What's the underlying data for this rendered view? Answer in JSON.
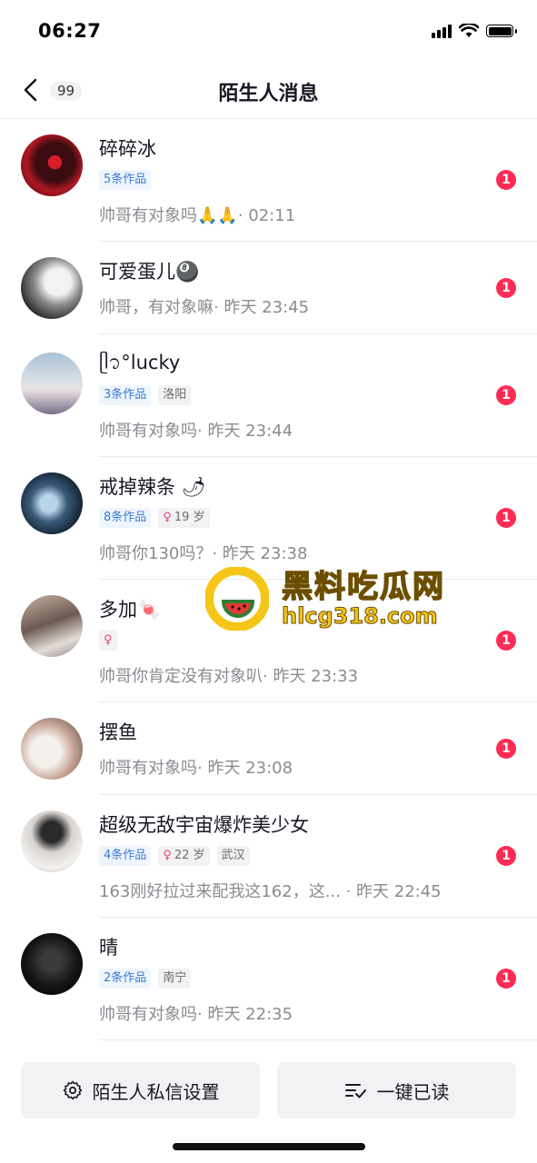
{
  "status_bar": {
    "time": "06:27"
  },
  "nav": {
    "unread_count": "99",
    "title": "陌生人消息"
  },
  "messages": [
    {
      "name": "碎碎冰",
      "tags": [
        "5条作品"
      ],
      "preview": "帅哥有对象吗🙏🙏· 02:11",
      "badge": "1"
    },
    {
      "name": "可爱蛋儿🎱",
      "tags": [],
      "preview": "帅哥，有对象嘛· 昨天 23:45",
      "badge": "1"
    },
    {
      "name": "ᥫ᭡°lucky",
      "tags": [
        "3条作品",
        "洛阳"
      ],
      "preview": "帅哥有对象吗· 昨天 23:44",
      "badge": "1"
    },
    {
      "name": "戒掉辣条 🌶",
      "tags": [
        "8条作品",
        "19 岁"
      ],
      "preview": "帅哥你130吗？· 昨天 23:38",
      "badge": "1"
    },
    {
      "name": "多加🍬",
      "tags": [
        ""
      ],
      "preview": "帅哥你肯定没有对象叭· 昨天 23:33",
      "badge": "1"
    },
    {
      "name": "摆鱼",
      "tags": [],
      "preview": "帅哥有对象吗· 昨天 23:08",
      "badge": "1"
    },
    {
      "name": "超级无敌宇宙爆炸美少女",
      "tags": [
        "4条作品",
        "22 岁",
        "武汉"
      ],
      "preview": "163刚好拉过来配我这162，这...  · 昨天 22:45",
      "badge": "1"
    },
    {
      "name": "晴",
      "tags": [
        "2条作品",
        "南宁"
      ],
      "preview": "帅哥有对象吗· 昨天 22:35",
      "badge": "1"
    }
  ],
  "watermark": {
    "title": "黑料吃瓜网",
    "url": "hlcg318.com"
  },
  "bottom": {
    "settings_label": "陌生人私信设置",
    "read_all_label": "一键已读"
  },
  "colors": {
    "badge": "#fe2c55",
    "works_tag_text": "#3a7ad1",
    "watermark": "#f5c518"
  }
}
